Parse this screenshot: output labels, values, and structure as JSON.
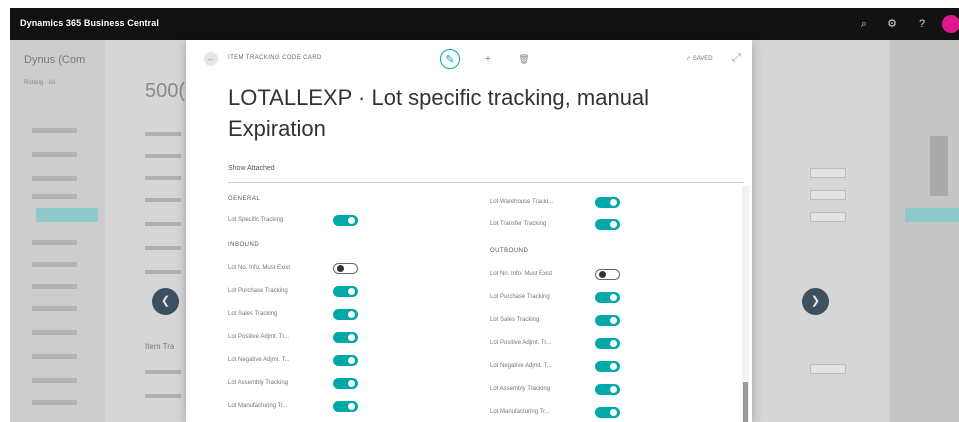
{
  "app": {
    "title": "Dynamics 365 Business Central"
  },
  "topbar_icons": [
    "search-icon",
    "gear-icon",
    "help-icon"
  ],
  "background": {
    "list_title": "Dynus (Com",
    "list_subtitle": "Rotang  · All ·",
    "record_number": "500(",
    "section_label": "Item Tra"
  },
  "modal": {
    "caption": "ITEM TRACKING CODE CARD",
    "saved_label": "✓ SAVED",
    "title": "LOTALLEXP · Lot specific tracking, manual Expiration",
    "show_attached": "Show Attached",
    "general": {
      "heading": "GENERAL",
      "fields": [
        {
          "label": "Lot Specific Tracking",
          "on": true
        }
      ]
    },
    "inbound": {
      "heading": "INBOUND",
      "fields": [
        {
          "label": "Lot No. Info. Must Exist",
          "on": false
        },
        {
          "label": "Lot Purchase Tracking",
          "on": true
        },
        {
          "label": "Lot Sales Tracking",
          "on": true
        },
        {
          "label": "Lot Positive Adjmt. Tr...",
          "on": true
        },
        {
          "label": "Lot Negative Adjmt. T...",
          "on": true
        },
        {
          "label": "Lot Assembly Tracking",
          "on": true
        },
        {
          "label": "Lot Manufacturing Tr...",
          "on": true
        }
      ]
    },
    "right_top": {
      "fields": [
        {
          "label": "Lot Warehouse Tracki...",
          "on": true
        },
        {
          "label": "Lot Transfer Tracking",
          "on": true
        }
      ]
    },
    "outbound": {
      "heading": "OUTBOUND",
      "fields": [
        {
          "label": "Lot No. Info. Must Exist",
          "on": false
        },
        {
          "label": "Lot Purchase Tracking",
          "on": true
        },
        {
          "label": "Lot Sales Tracking",
          "on": true
        },
        {
          "label": "Lot Positive Adjmt. Tr...",
          "on": true
        },
        {
          "label": "Lot Negative Adjmt. T...",
          "on": true
        },
        {
          "label": "Lot Assembly Tracking",
          "on": true
        },
        {
          "label": "Lot Manufacturing Tr...",
          "on": true
        }
      ]
    }
  },
  "colors": {
    "accent": "#00a8a8",
    "appbar": "#111111",
    "avatar": "#e0188c",
    "nav_button": "#3d5060"
  }
}
